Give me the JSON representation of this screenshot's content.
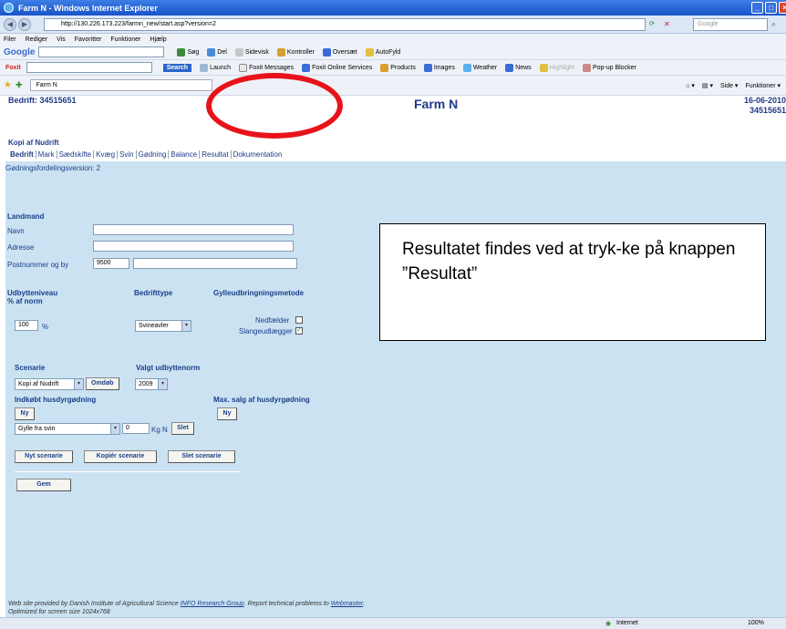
{
  "window": {
    "title": "Farm N - Windows Internet Explorer"
  },
  "browser": {
    "address": "http://130.226.173.223/farmn_new/start.asp?version=2",
    "search_placeholder": "Google",
    "menu": [
      "Filer",
      "Rediger",
      "Vis",
      "Favoritter",
      "Funktioner",
      "Hjælp"
    ],
    "google_bar": [
      "Søg",
      "Del",
      "Sidevisk",
      "Kontroller",
      "Oversæt",
      "AutoFyld"
    ],
    "foxit_bar": {
      "label": "Foxit",
      "search": "Search",
      "items": [
        "Launch",
        "Foxit Messages",
        "Foxit Online Services",
        "Products",
        "Images",
        "Weather",
        "News",
        "Highlight",
        "Pop-up Blocker"
      ]
    },
    "tab_label": "Farm N",
    "tab_tools": [
      "Side",
      "Funktioner"
    ]
  },
  "page": {
    "bedrift": "Bedrift: 34515651",
    "brand": "Farm N",
    "date": "16-06-2010",
    "date_id": "34515651",
    "kopi": "Kopi af Nudrift",
    "nav": [
      "Bedrift",
      "Mark",
      "Sædskifte",
      "Kvæg",
      "Svin",
      "Gødning",
      "Balance",
      "Resultat",
      "Dokumentation"
    ],
    "version_line": "Gødningsfordelingsversion: 2"
  },
  "form": {
    "landmand": "Landmand",
    "navn": "Navn",
    "adresse": "Adresse",
    "postnummer_label": "Postnummer og by",
    "postnummer": "9500",
    "udbytteniveau": "Udbytteniveau",
    "udbytte_unit_line": "% af norm",
    "bedrifttype": "Bedrifttype",
    "gylle_method": "Gylleudbringningsmetode",
    "udbytte_value": "100",
    "udbytte_pct": "%",
    "bedrifttype_value": "Svineavler",
    "nedfaelder": "Nedfælder",
    "slangeudlaegger": "Slangeudlægger",
    "scenarie": "Scenarie",
    "valgt_udbytte": "Valgt udbyttenorm",
    "scenarie_value": "Kopi af Nudrift",
    "omdoeb": "Omdøb",
    "year": "2009",
    "indkoebt": "Indkøbt husdyrgødning",
    "max_salg": "Max. salg af husdyrgødning",
    "ny": "Ny",
    "gylle_type": "Gylle fra svin",
    "gylle_amount": "0",
    "kg_n": "Kg N",
    "slet": "Slet",
    "nyt_scenarie": "Nyt scenarie",
    "kopier_scenarie": "Kopiér scenarie",
    "slet_scenarie": "Slet scenarie",
    "gem": "Gem"
  },
  "callout": "Resultatet findes ved at tryk-ke på knappen ”Resultat”",
  "footer": {
    "line1_a": "Web site provided by Danish Institute of Agricultural Science ",
    "line1_link": "INFO Research Group",
    "line1_b": ". Report technical problems to ",
    "line1_link2": "Webmaster",
    "line2": "Optimized for screen size 1024x768"
  },
  "status": {
    "zone": "Internet",
    "zoom": "100%"
  },
  "colors": {
    "highlight": "#e8131a",
    "form_bg": "#cbe2f2",
    "brand": "#1f3a8a"
  }
}
